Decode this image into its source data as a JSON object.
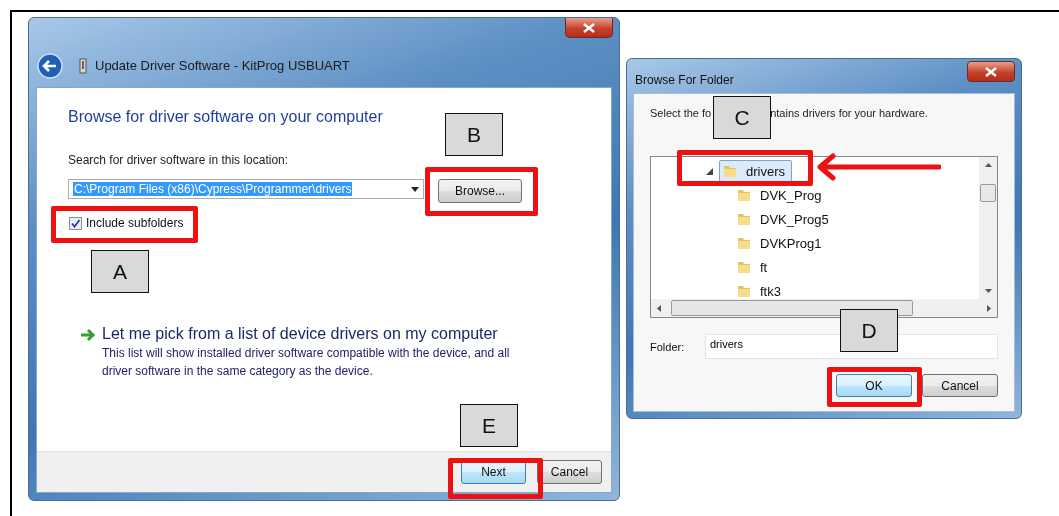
{
  "update_dialog": {
    "title": "Update Driver Software - KitProg USBUART",
    "heading": "Browse for driver software on your computer",
    "location_label": "Search for driver software in this location:",
    "location_field": {
      "value": "C:\\Program Files (x86)\\Cypress\\Programmer\\drivers",
      "highlighted": true
    },
    "browse_button": "Browse...",
    "include_subfolders": {
      "label": "Include subfolders",
      "checked": true
    },
    "pick_link": {
      "title": "Let me pick from a list of device drivers on my computer",
      "description": "This list will show installed driver software compatible with the device, and all driver software in the same category as the device."
    },
    "buttons": [
      {
        "label": "Next",
        "default": true
      },
      {
        "label": "Cancel",
        "default": false
      }
    ]
  },
  "folder_dialog": {
    "title": "Browse For Folder",
    "instruction_parts": [
      "Select the fo",
      "ntains drivers for your hardware."
    ],
    "tree": [
      {
        "label": "drivers",
        "expanded": true,
        "selected": true,
        "children": [
          {
            "label": "DVK_Prog",
            "selected": false
          },
          {
            "label": "DVK_Prog5",
            "selected": false
          },
          {
            "label": "DVKProg1",
            "selected": false
          },
          {
            "label": "ft",
            "selected": false
          },
          {
            "label": "ftk3",
            "selected": false
          }
        ]
      }
    ],
    "folder_label": "Folder:",
    "folder_field": {
      "value": "drivers"
    },
    "buttons": [
      {
        "label": "OK",
        "default": true
      },
      {
        "label": "Cancel",
        "default": false
      }
    ]
  },
  "annotations": [
    {
      "kind": "callout",
      "label": "A"
    },
    {
      "kind": "callout",
      "label": "B"
    },
    {
      "kind": "callout",
      "label": "C"
    },
    {
      "kind": "callout",
      "label": "D"
    },
    {
      "kind": "callout",
      "label": "E"
    },
    {
      "kind": "highlight"
    },
    {
      "kind": "highlight"
    },
    {
      "kind": "highlight"
    },
    {
      "kind": "highlight"
    },
    {
      "kind": "highlight"
    },
    {
      "kind": "arrow"
    }
  ]
}
